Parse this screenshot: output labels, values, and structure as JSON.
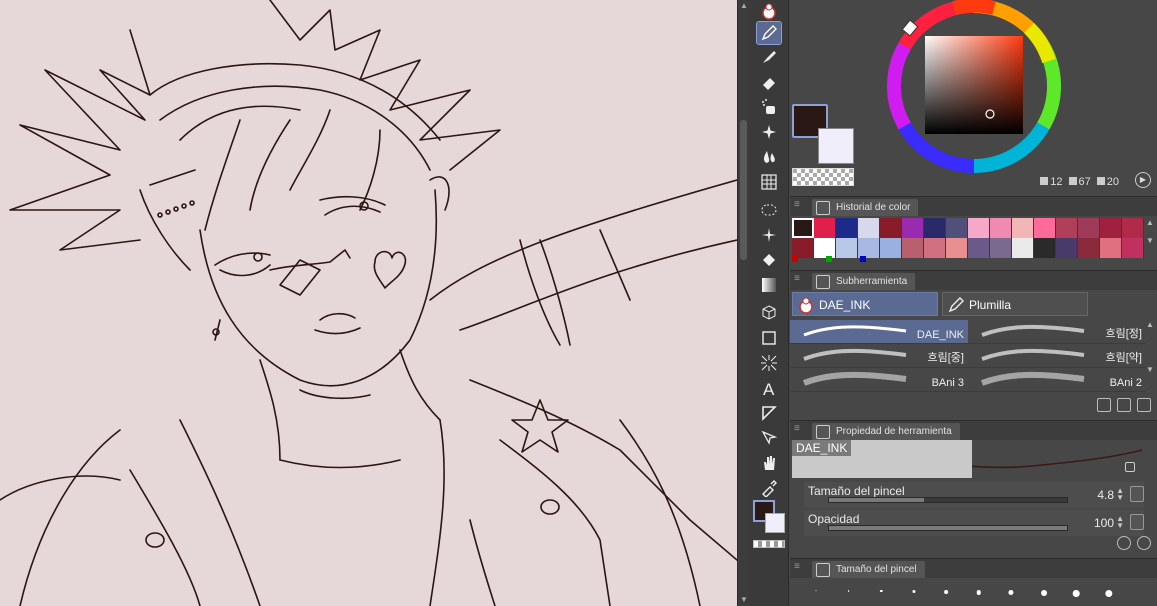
{
  "colors": {
    "main": "#2a1814",
    "sub": "#f0eefa",
    "accent": "#5b6a93"
  },
  "tools": [
    {
      "name": "snowman-icon"
    },
    {
      "name": "pen-icon",
      "active": true
    },
    {
      "name": "brush-icon"
    },
    {
      "name": "eraser-icon"
    },
    {
      "name": "airbrush-icon"
    },
    {
      "name": "sparkle-icon"
    },
    {
      "name": "blend-icon"
    },
    {
      "name": "grid-icon"
    },
    {
      "name": "lasso-icon"
    },
    {
      "name": "auto-select-icon"
    },
    {
      "name": "fill-icon"
    },
    {
      "name": "gradient-icon"
    },
    {
      "name": "figure-3d-icon"
    },
    {
      "name": "rectangle-icon"
    },
    {
      "name": "effect-line-icon"
    },
    {
      "name": "text-icon"
    },
    {
      "name": "frame-icon"
    },
    {
      "name": "operation-icon"
    },
    {
      "name": "hand-icon"
    },
    {
      "name": "eyedropper-icon"
    }
  ],
  "color_readout": {
    "h": "12",
    "s": "67",
    "v": "20"
  },
  "history": {
    "title": "Historial de color",
    "swatches": [
      "#2a1814",
      "#e0204a",
      "#1c2a8a",
      "#d8d8ec",
      "#8a1c2a",
      "#9a2ab0",
      "#2a2a6a",
      "#50507a",
      "#f6a8c8",
      "#f08ab0",
      "#f2b6b6",
      "#ff6a9a",
      "#b0405a",
      "#a03a5a",
      "#a02040",
      "#b02a4a",
      "#8a1c2a",
      "#ffffff",
      "#b8c8e8",
      "#a8b8e0",
      "#9ab0e0",
      "#b86070",
      "#d07080",
      "#e89090",
      "#6a5a8a",
      "#7a6a90",
      "#eaeaea",
      "#2a2a2a",
      "#4a3a6a",
      "#8a2a3a",
      "#e07080",
      "#c03060"
    ]
  },
  "subtool": {
    "title": "Subherramienta",
    "groups": [
      "DAE_INK",
      "Plumilla"
    ],
    "brushes": [
      "DAE_INK",
      "흐림[정]",
      "흐림[중]",
      "흐림[약]",
      "BAni 3",
      "BAni 2"
    ]
  },
  "toolprop": {
    "title": "Propiedad de herramienta",
    "preview_name": "DAE_INK",
    "rows": [
      {
        "label": "Tamaño del pincel",
        "value": "4.8",
        "fill": 0.4
      },
      {
        "label": "Opacidad",
        "value": "100",
        "fill": 1.0
      }
    ]
  },
  "brushsize": {
    "title": "Tamaño del pincel",
    "dot_count": 10
  }
}
